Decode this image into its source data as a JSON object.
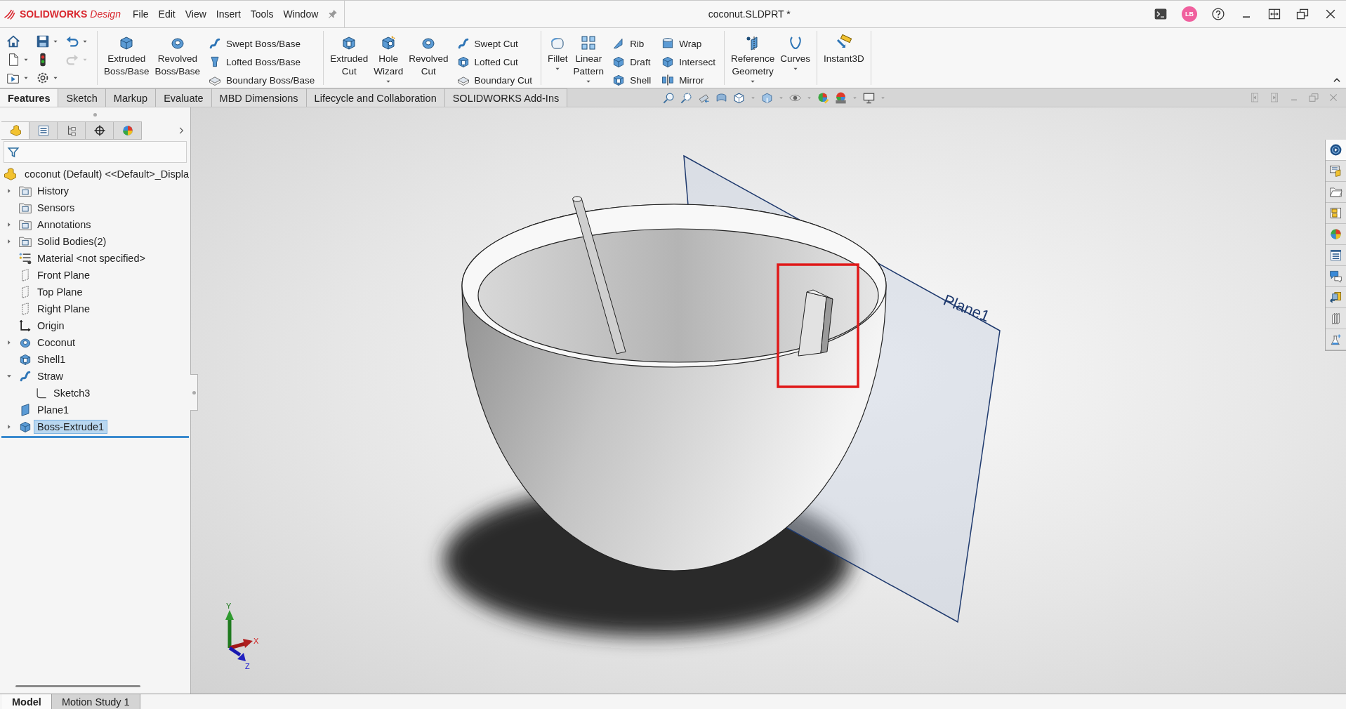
{
  "title_bar": {
    "logo": "**SOLIDWORKS** *Design*",
    "menu": [
      "File",
      "Edit",
      "View",
      "Insert",
      "Tools",
      "Window"
    ],
    "title": "coconut.SLDPRT *",
    "avatar": "LB"
  },
  "quick_access": [
    {
      "kind": "home",
      "dropdown": false,
      "disabled": false
    },
    {
      "kind": "save",
      "dropdown": true,
      "disabled": false
    },
    {
      "kind": "undo",
      "dropdown": true,
      "disabled": false
    },
    {
      "kind": "new",
      "dropdown": true,
      "disabled": false
    },
    {
      "kind": "rebuild",
      "dropdown": false,
      "disabled": false
    },
    {
      "kind": "redo",
      "dropdown": true,
      "disabled": true
    },
    {
      "kind": "open",
      "dropdown": true,
      "disabled": false
    },
    {
      "kind": "options",
      "dropdown": true,
      "disabled": false
    }
  ],
  "ribbon_groups": [
    {
      "large": [
        {
          "kind": "extrude",
          "label": "Extruded\nBoss/Base",
          "dropdown": false
        },
        {
          "kind": "revolve",
          "label": "Revolved\nBoss/Base",
          "dropdown": false
        }
      ],
      "stacks": [
        [
          {
            "kind": "sweep",
            "label": "Swept Boss/Base"
          },
          {
            "kind": "loft",
            "label": "Lofted Boss/Base"
          },
          {
            "kind": "boundary",
            "label": "Boundary Boss/Base"
          }
        ]
      ]
    },
    {
      "large": [
        {
          "kind": "cut",
          "label": "Extruded\nCut",
          "dropdown": false
        },
        {
          "kind": "hole",
          "label": "Hole\nWizard",
          "dropdown": true
        },
        {
          "kind": "revolve-cut",
          "label": "Revolved\nCut",
          "dropdown": false
        }
      ],
      "stacks": [
        [
          {
            "kind": "sweep-cut",
            "label": "Swept Cut"
          },
          {
            "kind": "loft-cut",
            "label": "Lofted Cut"
          },
          {
            "kind": "boundary-cut",
            "label": "Boundary Cut"
          }
        ]
      ]
    },
    {
      "large": [
        {
          "kind": "fillet",
          "label": "Fillet",
          "dropdown": true
        },
        {
          "kind": "pattern",
          "label": "Linear\nPattern",
          "dropdown": true
        }
      ],
      "stacks": [
        [
          {
            "kind": "rib",
            "label": "Rib"
          },
          {
            "kind": "draft",
            "label": "Draft"
          },
          {
            "kind": "shell",
            "label": "Shell"
          }
        ],
        [
          {
            "kind": "wrap",
            "label": "Wrap"
          },
          {
            "kind": "intersect",
            "label": "Intersect"
          },
          {
            "kind": "mirror",
            "label": "Mirror"
          }
        ]
      ]
    },
    {
      "large": [
        {
          "kind": "reference",
          "label": "Reference\nGeometry",
          "dropdown": true
        },
        {
          "kind": "curves",
          "label": "Curves",
          "dropdown": true
        }
      ]
    },
    {
      "large": [
        {
          "kind": "instant3d",
          "label": "Instant3D",
          "dropdown": false
        }
      ]
    }
  ],
  "command_tabs": [
    {
      "label": "Features",
      "selected": true
    },
    {
      "label": "Sketch",
      "selected": false
    },
    {
      "label": "Markup",
      "selected": false
    },
    {
      "label": "Evaluate",
      "selected": false
    },
    {
      "label": "MBD Dimensions",
      "selected": false
    },
    {
      "label": "Lifecycle and Collaboration",
      "selected": false
    },
    {
      "label": "SOLIDWORKS Add-Ins",
      "selected": false
    }
  ],
  "manager_tabs": [
    {
      "kind": "feature-tree",
      "selected": true
    },
    {
      "kind": "properties",
      "selected": false
    },
    {
      "kind": "configurations",
      "selected": false
    },
    {
      "kind": "dimxpert",
      "selected": false
    },
    {
      "kind": "display",
      "selected": false
    }
  ],
  "tree": {
    "label": "coconut (Default) <<Default>_Displa",
    "kind": "part",
    "selected": false,
    "children": [
      {
        "label": "History",
        "kind": "folder",
        "expanded": false,
        "selected": false
      },
      {
        "label": "Sensors",
        "kind": "folder",
        "selected": false
      },
      {
        "label": "Annotations",
        "kind": "folder",
        "expanded": false,
        "selected": false
      },
      {
        "label": "Solid Bodies(2)",
        "kind": "folder",
        "expanded": false,
        "selected": false
      },
      {
        "label": "Material <not specified>",
        "kind": "material",
        "selected": false
      },
      {
        "label": "Front Plane",
        "kind": "plane",
        "selected": false
      },
      {
        "label": "Top Plane",
        "kind": "plane",
        "selected": false
      },
      {
        "label": "Right Plane",
        "kind": "plane",
        "selected": false
      },
      {
        "label": "Origin",
        "kind": "origin",
        "selected": false
      },
      {
        "label": "Coconut",
        "kind": "revolve",
        "expanded": false,
        "selected": false
      },
      {
        "label": "Shell1",
        "kind": "shell",
        "selected": false
      },
      {
        "label": "Straw",
        "kind": "sweep",
        "expanded": true,
        "selected": false,
        "children": [
          {
            "label": "Sketch3",
            "kind": "sketch",
            "selected": false
          }
        ]
      },
      {
        "label": "Plane1",
        "kind": "ref-plane",
        "selected": false
      },
      {
        "label": "Boss-Extrude1",
        "kind": "extrude",
        "expanded": false,
        "selected": true
      }
    ]
  },
  "viewport": {
    "plane_label": "Plane1",
    "axes": {
      "x": "X",
      "y": "Y",
      "z": "Z"
    }
  },
  "task_pane": [
    {
      "kind": "resources",
      "selected": true
    },
    {
      "kind": "library",
      "selected": false
    },
    {
      "kind": "explorer",
      "selected": false
    },
    {
      "kind": "palette",
      "selected": false
    },
    {
      "kind": "appearances",
      "selected": false
    },
    {
      "kind": "properties",
      "selected": false
    },
    {
      "kind": "forum",
      "selected": false
    },
    {
      "kind": "parts",
      "selected": false
    },
    {
      "kind": "books",
      "selected": false
    },
    {
      "kind": "simulation",
      "selected": false
    }
  ],
  "bottom_tabs": [
    {
      "label": "Model",
      "selected": true
    },
    {
      "label": "Motion Study 1",
      "selected": false
    }
  ]
}
